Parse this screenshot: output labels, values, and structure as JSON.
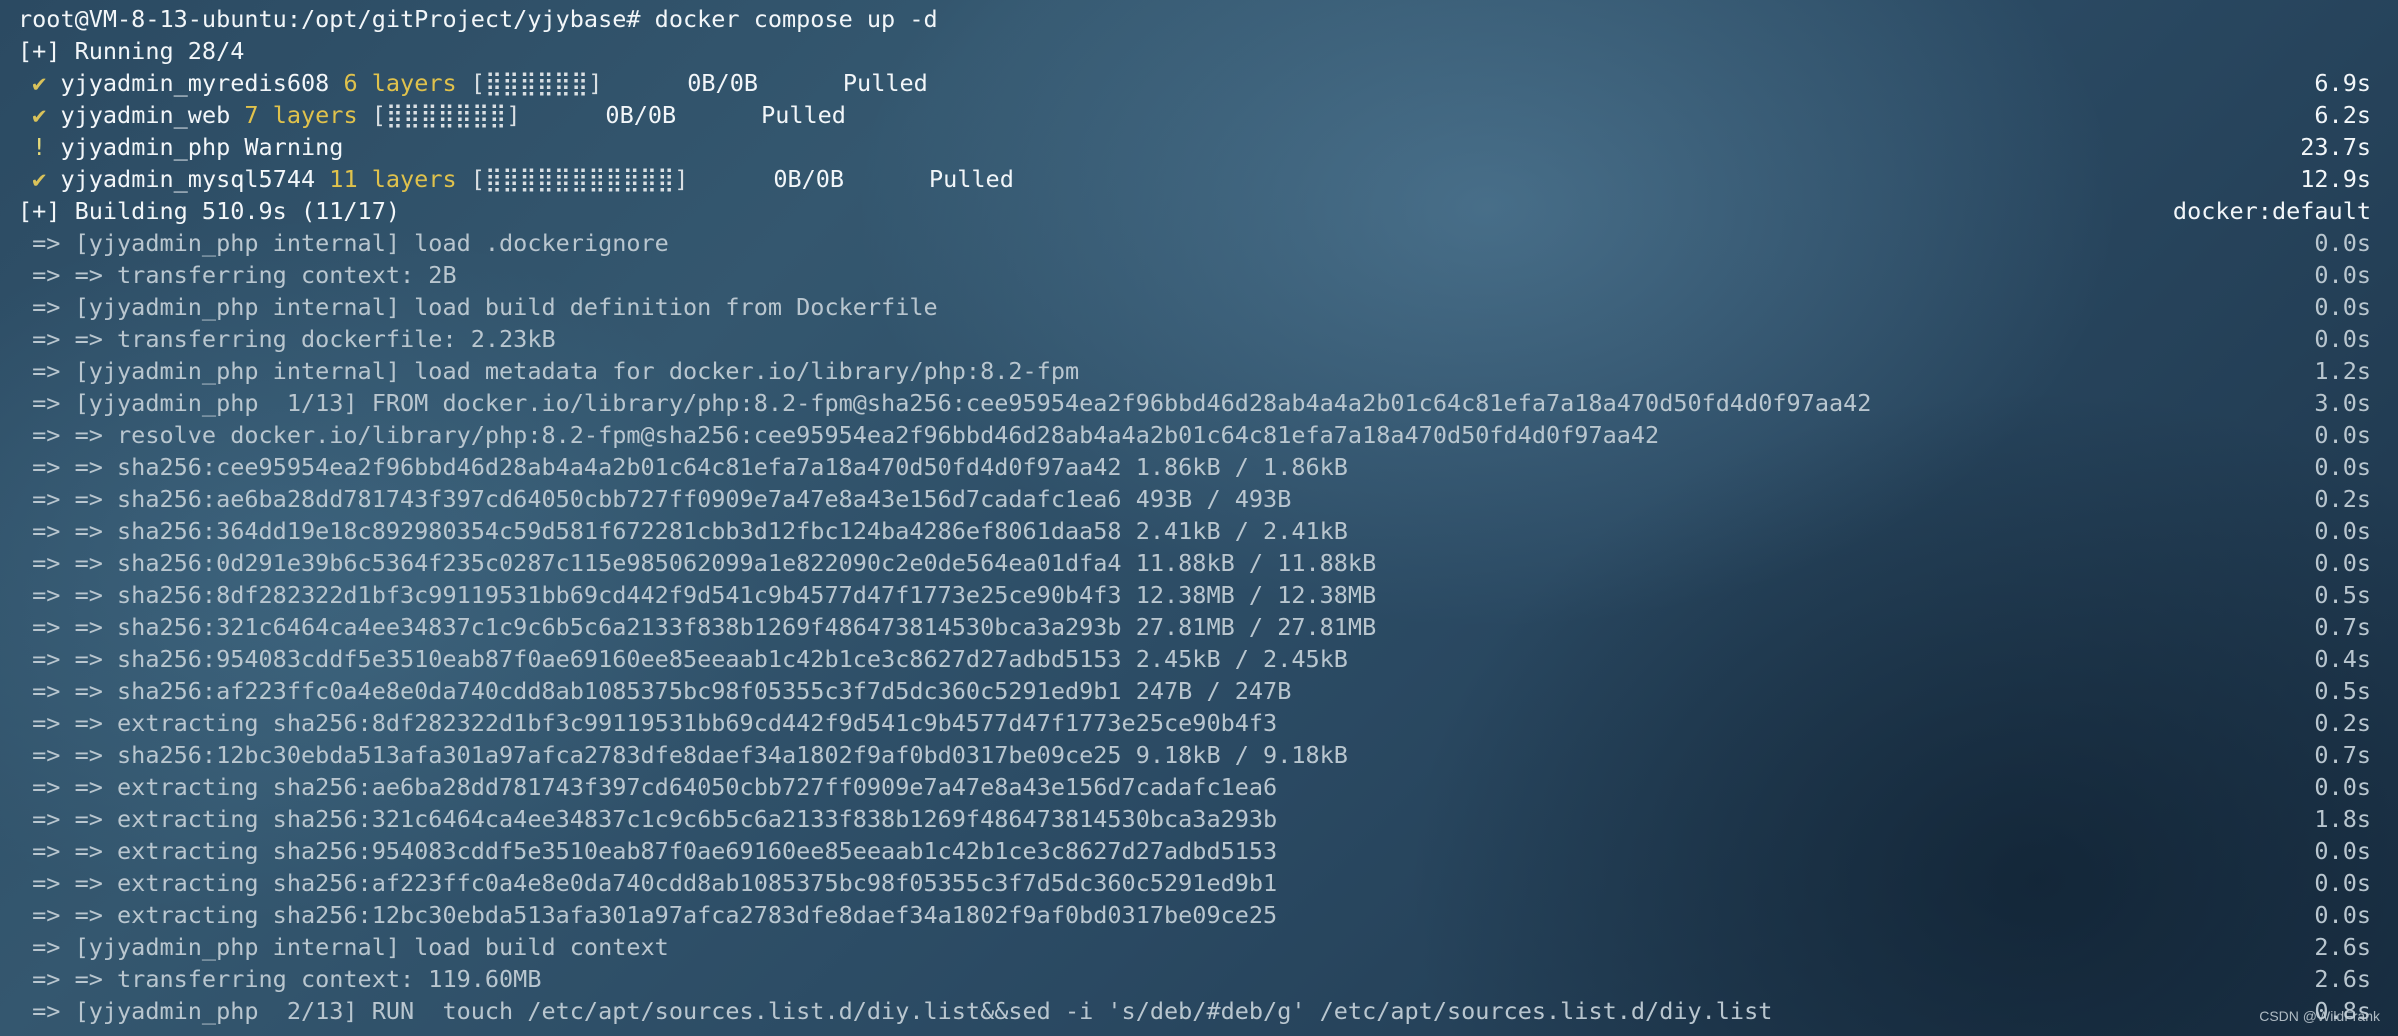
{
  "prompt": {
    "text": "root@VM-8-13-ubuntu:/opt/gitProject/yjybase# docker compose up -d"
  },
  "running": {
    "header": "[+] Running 28/4",
    "items": [
      {
        "mark": "✔",
        "name": "yjyadmin_myredis608",
        "layers": "6 layers",
        "bar": "[⣿⣿⣿⣿⣿⣿]",
        "size": "0B/0B",
        "status": "Pulled",
        "time": "6.9s"
      },
      {
        "mark": "✔",
        "name": "yjyadmin_web",
        "layers": "7 layers",
        "bar": "[⣿⣿⣿⣿⣿⣿⣿]",
        "size": "0B/0B",
        "status": "Pulled",
        "time": "6.2s"
      },
      {
        "mark": "!",
        "name": "yjyadmin_php",
        "layers": "",
        "bar": "",
        "size": "",
        "status": "Warning",
        "time": "23.7s"
      },
      {
        "mark": "✔",
        "name": "yjyadmin_mysql5744",
        "layers": "11 layers",
        "bar": "[⣿⣿⣿⣿⣿⣿⣿⣿⣿⣿⣿]",
        "size": "0B/0B",
        "status": "Pulled",
        "time": "12.9s"
      }
    ]
  },
  "building": {
    "header": "[+] Building 510.9s (11/17)",
    "context": "docker:default",
    "steps": [
      {
        "text": " => [yjyadmin_php internal] load .dockerignore",
        "time": "0.0s"
      },
      {
        "text": " => => transferring context: 2B",
        "time": "0.0s"
      },
      {
        "text": " => [yjyadmin_php internal] load build definition from Dockerfile",
        "time": "0.0s"
      },
      {
        "text": " => => transferring dockerfile: 2.23kB",
        "time": "0.0s"
      },
      {
        "text": " => [yjyadmin_php internal] load metadata for docker.io/library/php:8.2-fpm",
        "time": "1.2s"
      },
      {
        "text": " => [yjyadmin_php  1/13] FROM docker.io/library/php:8.2-fpm@sha256:cee95954ea2f96bbd46d28ab4a4a2b01c64c81efa7a18a470d50fd4d0f97aa42",
        "time": "3.0s"
      },
      {
        "text": " => => resolve docker.io/library/php:8.2-fpm@sha256:cee95954ea2f96bbd46d28ab4a4a2b01c64c81efa7a18a470d50fd4d0f97aa42",
        "time": "0.0s"
      },
      {
        "text": " => => sha256:cee95954ea2f96bbd46d28ab4a4a2b01c64c81efa7a18a470d50fd4d0f97aa42 1.86kB / 1.86kB",
        "time": "0.0s"
      },
      {
        "text": " => => sha256:ae6ba28dd781743f397cd64050cbb727ff0909e7a47e8a43e156d7cadafc1ea6 493B / 493B",
        "time": "0.2s"
      },
      {
        "text": " => => sha256:364dd19e18c892980354c59d581f672281cbb3d12fbc124ba4286ef8061daa58 2.41kB / 2.41kB",
        "time": "0.0s"
      },
      {
        "text": " => => sha256:0d291e39b6c5364f235c0287c115e985062099a1e822090c2e0de564ea01dfa4 11.88kB / 11.88kB",
        "time": "0.0s"
      },
      {
        "text": " => => sha256:8df282322d1bf3c99119531bb69cd442f9d541c9b4577d47f1773e25ce90b4f3 12.38MB / 12.38MB",
        "time": "0.5s"
      },
      {
        "text": " => => sha256:321c6464ca4ee34837c1c9c6b5c6a2133f838b1269f486473814530bca3a293b 27.81MB / 27.81MB",
        "time": "0.7s"
      },
      {
        "text": " => => sha256:954083cddf5e3510eab87f0ae69160ee85eeaab1c42b1ce3c8627d27adbd5153 2.45kB / 2.45kB",
        "time": "0.4s"
      },
      {
        "text": " => => sha256:af223ffc0a4e8e0da740cdd8ab1085375bc98f05355c3f7d5dc360c5291ed9b1 247B / 247B",
        "time": "0.5s"
      },
      {
        "text": " => => extracting sha256:8df282322d1bf3c99119531bb69cd442f9d541c9b4577d47f1773e25ce90b4f3",
        "time": "0.2s"
      },
      {
        "text": " => => sha256:12bc30ebda513afa301a97afca2783dfe8daef34a1802f9af0bd0317be09ce25 9.18kB / 9.18kB",
        "time": "0.7s"
      },
      {
        "text": " => => extracting sha256:ae6ba28dd781743f397cd64050cbb727ff0909e7a47e8a43e156d7cadafc1ea6",
        "time": "0.0s"
      },
      {
        "text": " => => extracting sha256:321c6464ca4ee34837c1c9c6b5c6a2133f838b1269f486473814530bca3a293b",
        "time": "1.8s"
      },
      {
        "text": " => => extracting sha256:954083cddf5e3510eab87f0ae69160ee85eeaab1c42b1ce3c8627d27adbd5153",
        "time": "0.0s"
      },
      {
        "text": " => => extracting sha256:af223ffc0a4e8e0da740cdd8ab1085375bc98f05355c3f7d5dc360c5291ed9b1",
        "time": "0.0s"
      },
      {
        "text": " => => extracting sha256:12bc30ebda513afa301a97afca2783dfe8daef34a1802f9af0bd0317be09ce25",
        "time": "0.0s"
      },
      {
        "text": " => [yjyadmin_php internal] load build context",
        "time": "2.6s"
      },
      {
        "text": " => => transferring context: 119.60MB",
        "time": "2.6s"
      },
      {
        "text": " => [yjyadmin_php  2/13] RUN  touch /etc/apt/sources.list.d/diy.list&&sed -i 's/deb/#deb/g' /etc/apt/sources.list.d/diy.list",
        "time": "0.8s"
      }
    ]
  },
  "watermark": "CSDN @WildFrank"
}
